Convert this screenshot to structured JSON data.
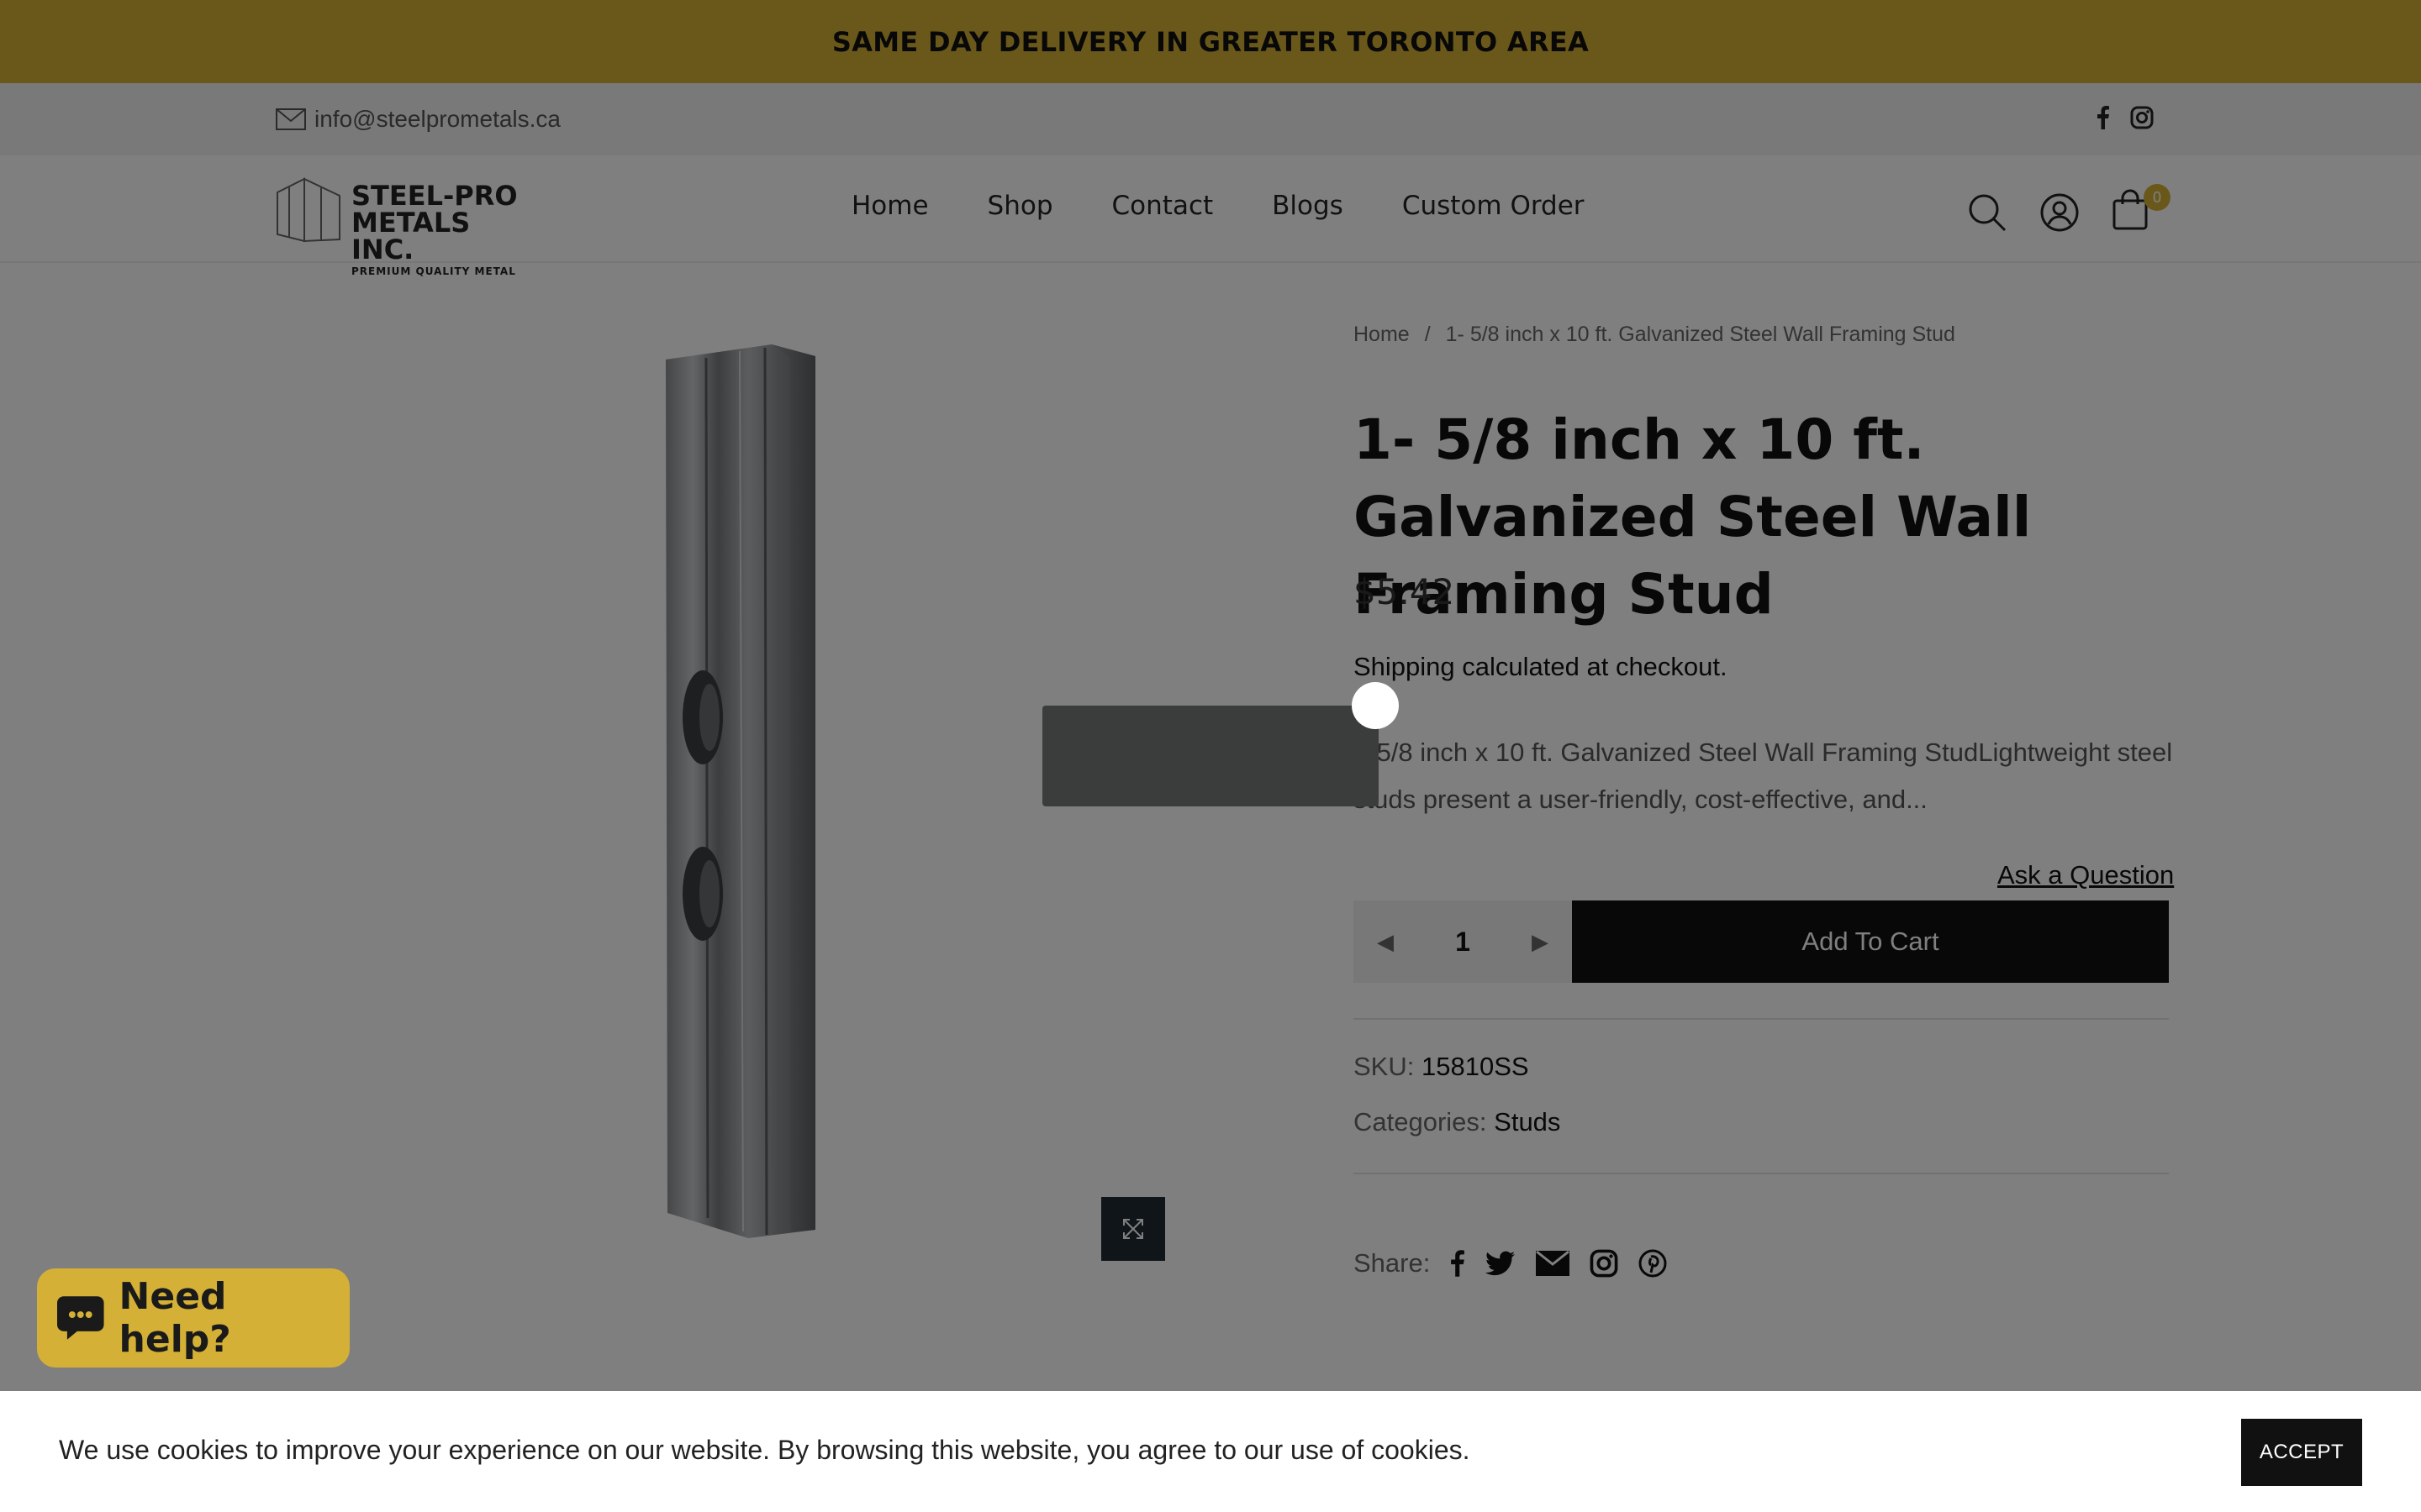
{
  "announcement": {
    "text": "SAME DAY DELIVERY IN GREATER TORONTO AREA"
  },
  "topbar": {
    "email": "info@steelprometals.ca",
    "social": [
      "facebook-icon",
      "instagram-icon"
    ]
  },
  "header": {
    "logo": {
      "line1": "STEEL-PRO",
      "line2": "METALS INC.",
      "line3": "PREMIUM QUALITY METAL"
    },
    "nav": [
      "Home",
      "Shop",
      "Contact",
      "Blogs",
      "Custom Order"
    ],
    "cart_count": "0"
  },
  "breadcrumb": {
    "home": "Home",
    "sep": "/",
    "current": "1- 5/8 inch x 10 ft. Galvanized Steel Wall Framing Stud"
  },
  "product": {
    "title": "1- 5/8 inch x 10 ft. Galvanized Steel Wall Framing Stud",
    "price": "$5.42",
    "shipping_link": "Shipping",
    "shipping_rest": " calculated at checkout.",
    "description": "1-5/8 inch x 10 ft. Galvanized Steel Wall Framing StudLightweight steel studs present a user-friendly, cost-effective, and...",
    "ask_question": "Ask a Question",
    "quantity": "1",
    "qty_down": "◀",
    "qty_up": "▶",
    "add_to_cart": "Add To Cart",
    "sku_label": "SKU:",
    "sku": "15810SS",
    "categories_label": "Categories:",
    "category": "Studs",
    "share_label": "Share:"
  },
  "chat": {
    "label": "Need help?"
  },
  "cookie": {
    "message": "We use cookies to improve your experience on our website. By browsing this website, you agree to our use of cookies.",
    "accept": "ACCEPT"
  },
  "colors": {
    "accent": "#d4b037",
    "dark": "#111111",
    "overlay": "rgba(0,0,0,0.5)"
  }
}
